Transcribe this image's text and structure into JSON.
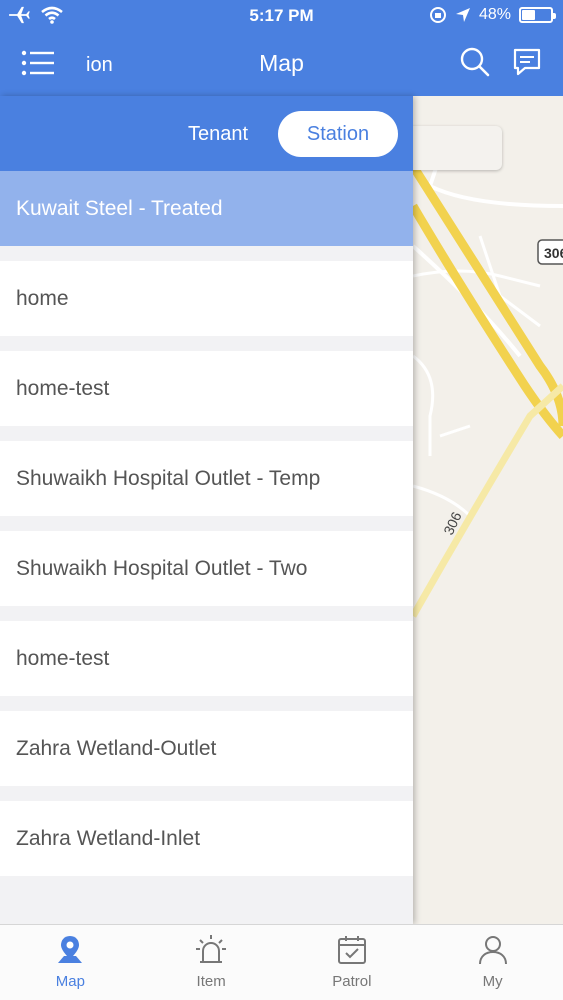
{
  "status_bar": {
    "time": "5:17 PM",
    "battery": "48%",
    "battery_level": 0.48
  },
  "header": {
    "title": "Map",
    "subtitle": "ion"
  },
  "segmented": {
    "tenant_label": "Tenant",
    "station_label": "Station",
    "selected": "Station"
  },
  "stations": [
    {
      "label": "Kuwait Steel - Treated",
      "selected": true
    },
    {
      "label": "home",
      "selected": false
    },
    {
      "label": "home-test",
      "selected": false
    },
    {
      "label": "Shuwaikh Hospital Outlet - Temp",
      "selected": false
    },
    {
      "label": "Shuwaikh Hospital Outlet - Two",
      "selected": false
    },
    {
      "label": "home-test",
      "selected": false
    },
    {
      "label": "Zahra Wetland-Outlet",
      "selected": false
    },
    {
      "label": "Zahra Wetland-Inlet",
      "selected": false
    }
  ],
  "map": {
    "road_label_1": "306",
    "road_label_2": "306"
  },
  "tabbar": {
    "map": "Map",
    "item": "Item",
    "patrol": "Patrol",
    "my": "My"
  },
  "colors": {
    "primary": "#4a80e0",
    "selected_row": "#92b2ec",
    "road": "#f2d24e"
  }
}
